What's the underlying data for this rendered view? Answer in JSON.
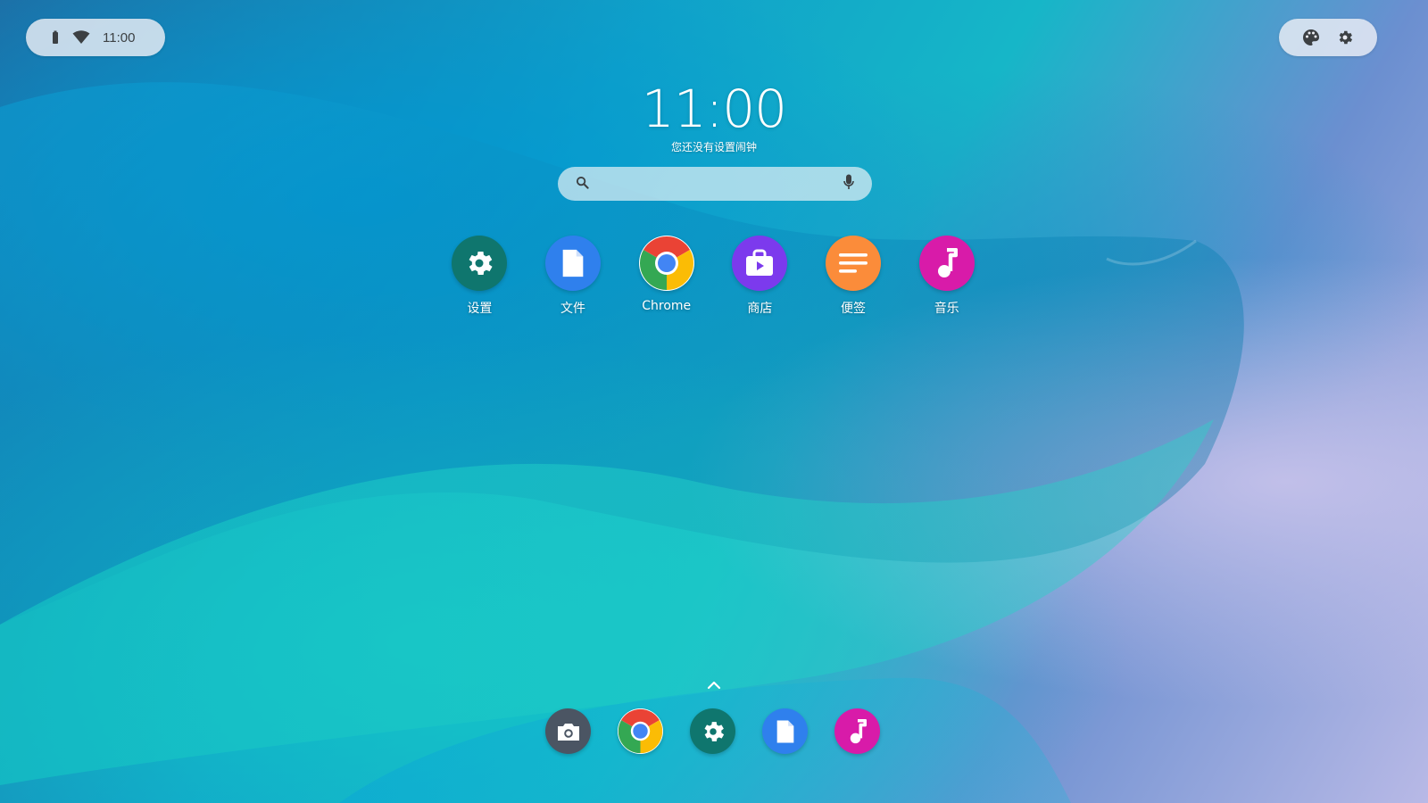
{
  "status_bar": {
    "time": "11:00",
    "icons": [
      "battery-icon",
      "wifi-icon"
    ]
  },
  "quick_settings": {
    "icons": [
      "palette-icon",
      "gear-icon"
    ]
  },
  "clock": {
    "time": "11:00",
    "alarm_text": "您还没有设置闹钟"
  },
  "search": {
    "placeholder": "",
    "icons": [
      "search-icon",
      "mic-icon"
    ]
  },
  "apps": [
    {
      "label": "设置",
      "icon": "settings-gear-icon",
      "color": "#0f766e"
    },
    {
      "label": "文件",
      "icon": "file-icon",
      "color": "#2f80ed"
    },
    {
      "label": "Chrome",
      "icon": "chrome-icon",
      "color": "#ffffff"
    },
    {
      "label": "商店",
      "icon": "store-icon",
      "color": "#7c3aed"
    },
    {
      "label": "便签",
      "icon": "notes-icon",
      "color": "#fb8c3a"
    },
    {
      "label": "音乐",
      "icon": "music-note-icon",
      "color": "#d81ba9"
    }
  ],
  "dock": [
    {
      "icon": "camera-icon",
      "color": "#4b5563"
    },
    {
      "icon": "chrome-icon",
      "color": "#ffffff"
    },
    {
      "icon": "settings-gear-icon",
      "color": "#0f766e"
    },
    {
      "icon": "file-icon",
      "color": "#2f80ed"
    },
    {
      "icon": "music-note-icon",
      "color": "#d81ba9"
    }
  ],
  "app_drawer": {
    "icon": "chevron-up-icon"
  }
}
